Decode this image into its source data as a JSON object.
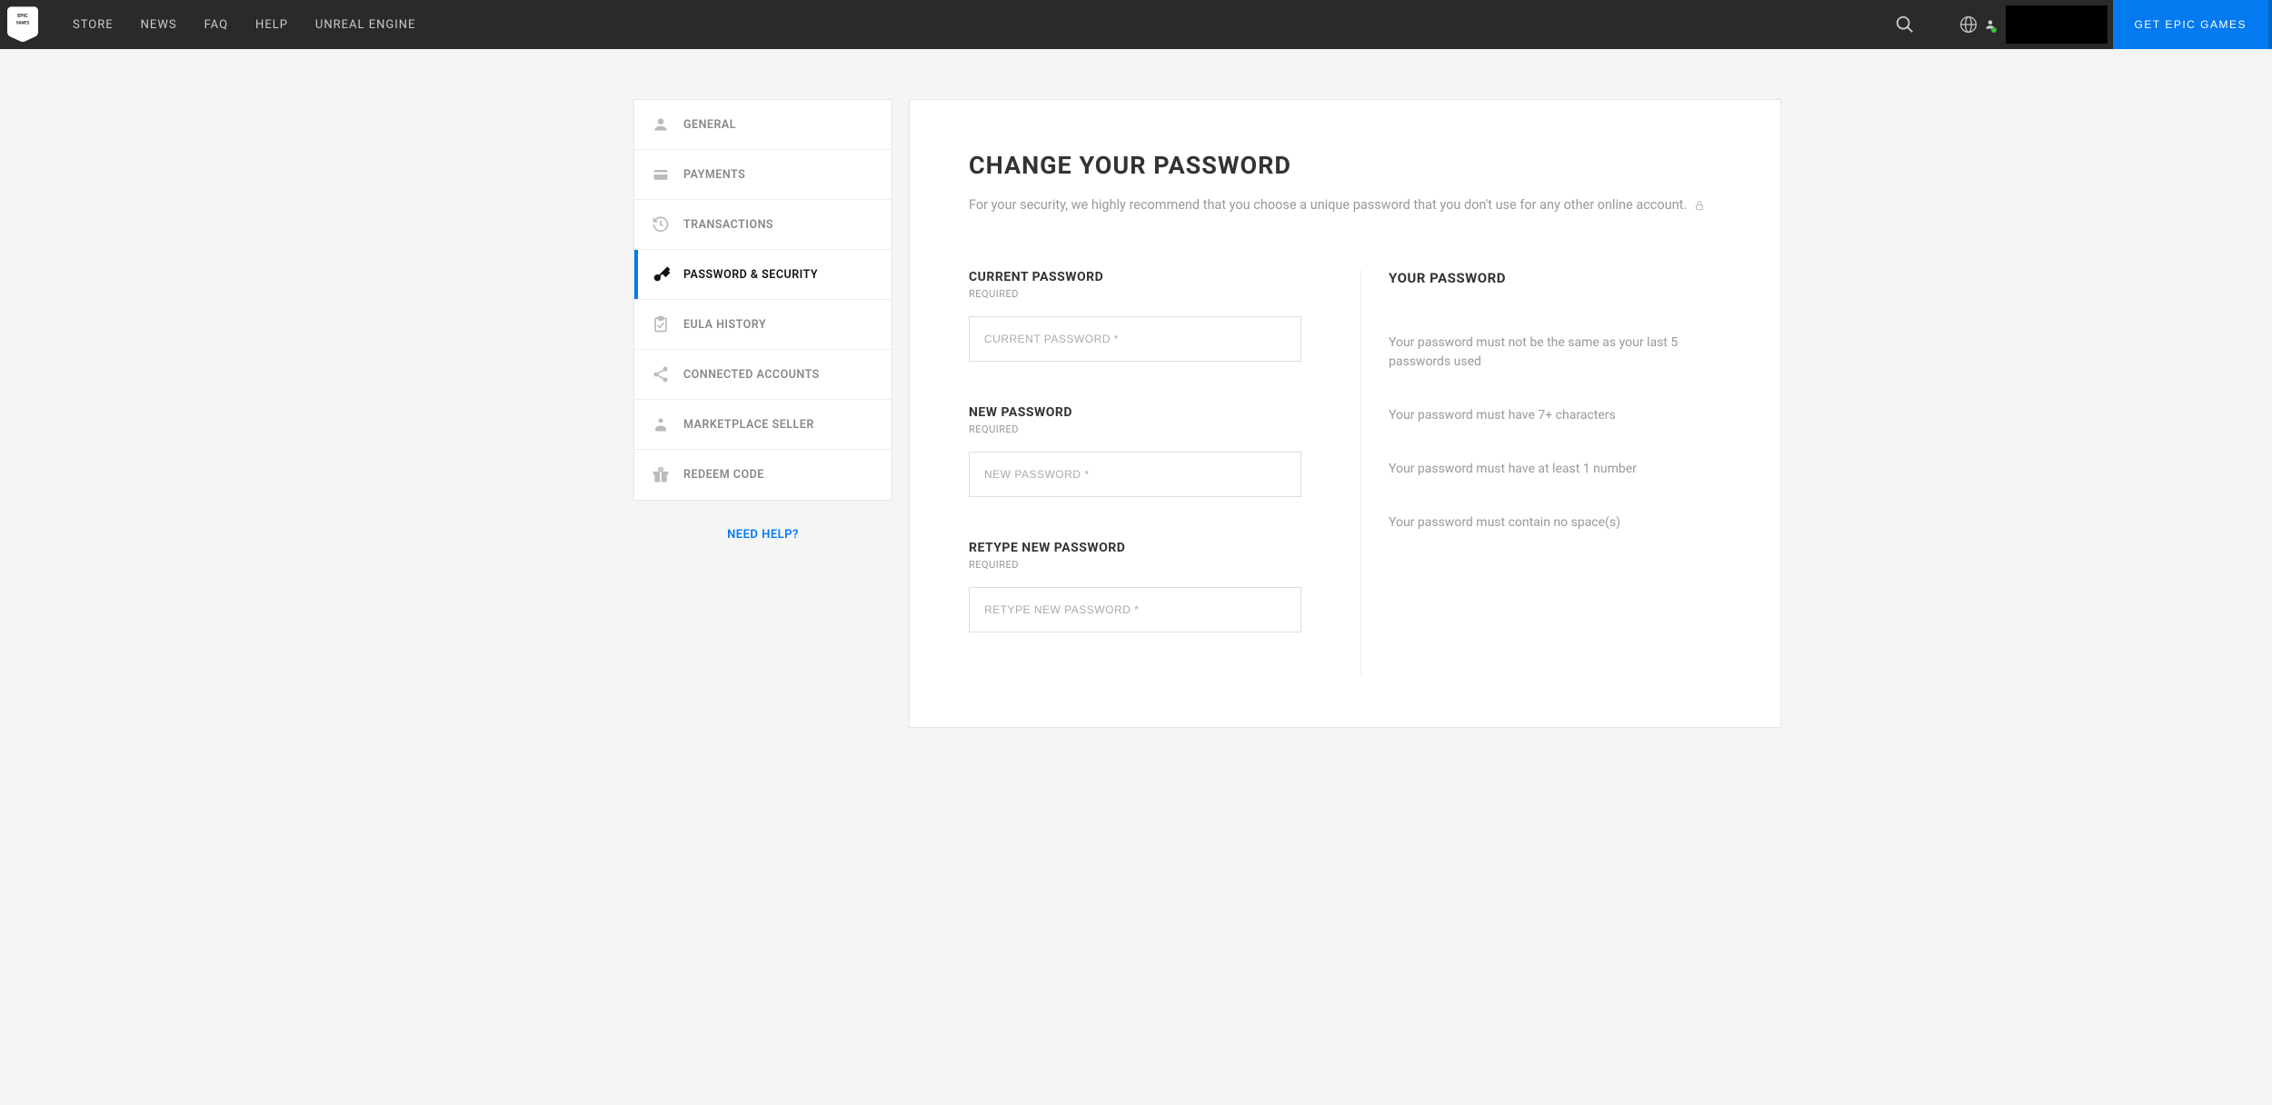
{
  "header": {
    "nav": [
      "STORE",
      "NEWS",
      "FAQ",
      "HELP",
      "UNREAL ENGINE"
    ],
    "cta": "GET EPIC GAMES"
  },
  "sidebar": {
    "items": [
      {
        "label": "GENERAL"
      },
      {
        "label": "PAYMENTS"
      },
      {
        "label": "TRANSACTIONS"
      },
      {
        "label": "PASSWORD & SECURITY"
      },
      {
        "label": "EULA HISTORY"
      },
      {
        "label": "CONNECTED ACCOUNTS"
      },
      {
        "label": "MARKETPLACE SELLER"
      },
      {
        "label": "REDEEM CODE"
      }
    ],
    "need_help": "NEED HELP?"
  },
  "main": {
    "title": "CHANGE YOUR PASSWORD",
    "subtitle": "For your security, we highly recommend that you choose a unique password that you don't use for any other online account.",
    "fields": {
      "current": {
        "label": "CURRENT PASSWORD",
        "required": "REQUIRED",
        "placeholder": "CURRENT PASSWORD *"
      },
      "new": {
        "label": "NEW PASSWORD",
        "required": "REQUIRED",
        "placeholder": "NEW PASSWORD *"
      },
      "retype": {
        "label": "RETYPE NEW PASSWORD",
        "required": "REQUIRED",
        "placeholder": "RETYPE NEW PASSWORD *"
      }
    },
    "rules": {
      "title": "YOUR PASSWORD",
      "items": [
        "Your password must not be the same as your last 5 passwords used",
        "Your password must have 7+ characters",
        "Your password must have at least 1 number",
        "Your password must contain no space(s)"
      ]
    }
  }
}
